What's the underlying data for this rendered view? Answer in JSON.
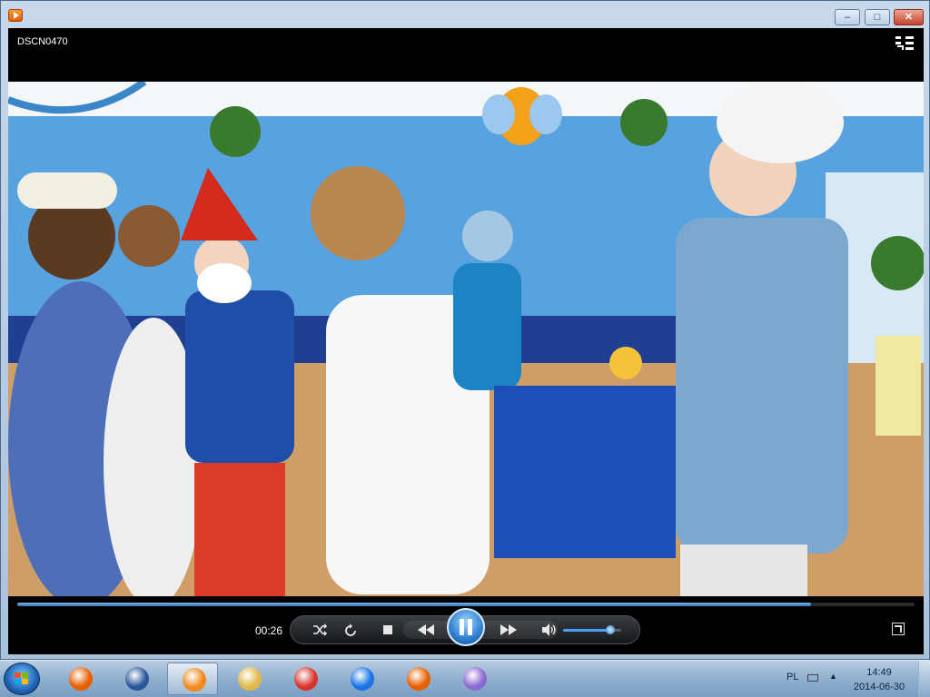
{
  "window": {
    "title": "DSCN0470",
    "controls": {
      "minimize": "–",
      "maximize": "□",
      "close": "✕"
    }
  },
  "player": {
    "elapsed_time": "00:26",
    "progress_fraction": 0.885,
    "volume_fraction": 0.82,
    "icons": [
      "switch-to-library-icon",
      "shuffle-icon",
      "repeat-icon",
      "stop-icon",
      "previous-icon",
      "play-pause-icon",
      "next-icon",
      "volume-icon",
      "fullscreen-icon"
    ],
    "accent_color": "#2f7fd0"
  },
  "taskbar": {
    "items": [
      {
        "name": "firefox",
        "color": "#e66000"
      },
      {
        "name": "word",
        "color": "#2b579a"
      },
      {
        "name": "windows-media-player",
        "color": "#f08a1c",
        "active": true
      },
      {
        "name": "file-explorer",
        "color": "#e3b84a"
      },
      {
        "name": "generic-app",
        "color": "#d9342b"
      },
      {
        "name": "chrome",
        "color": "#1a73e8"
      },
      {
        "name": "firefox",
        "color": "#e66000"
      },
      {
        "name": "paint",
        "color": "#8a6ad2"
      }
    ],
    "tray": {
      "language": "PL",
      "time": "14:49",
      "date": "2014-06-30"
    }
  }
}
